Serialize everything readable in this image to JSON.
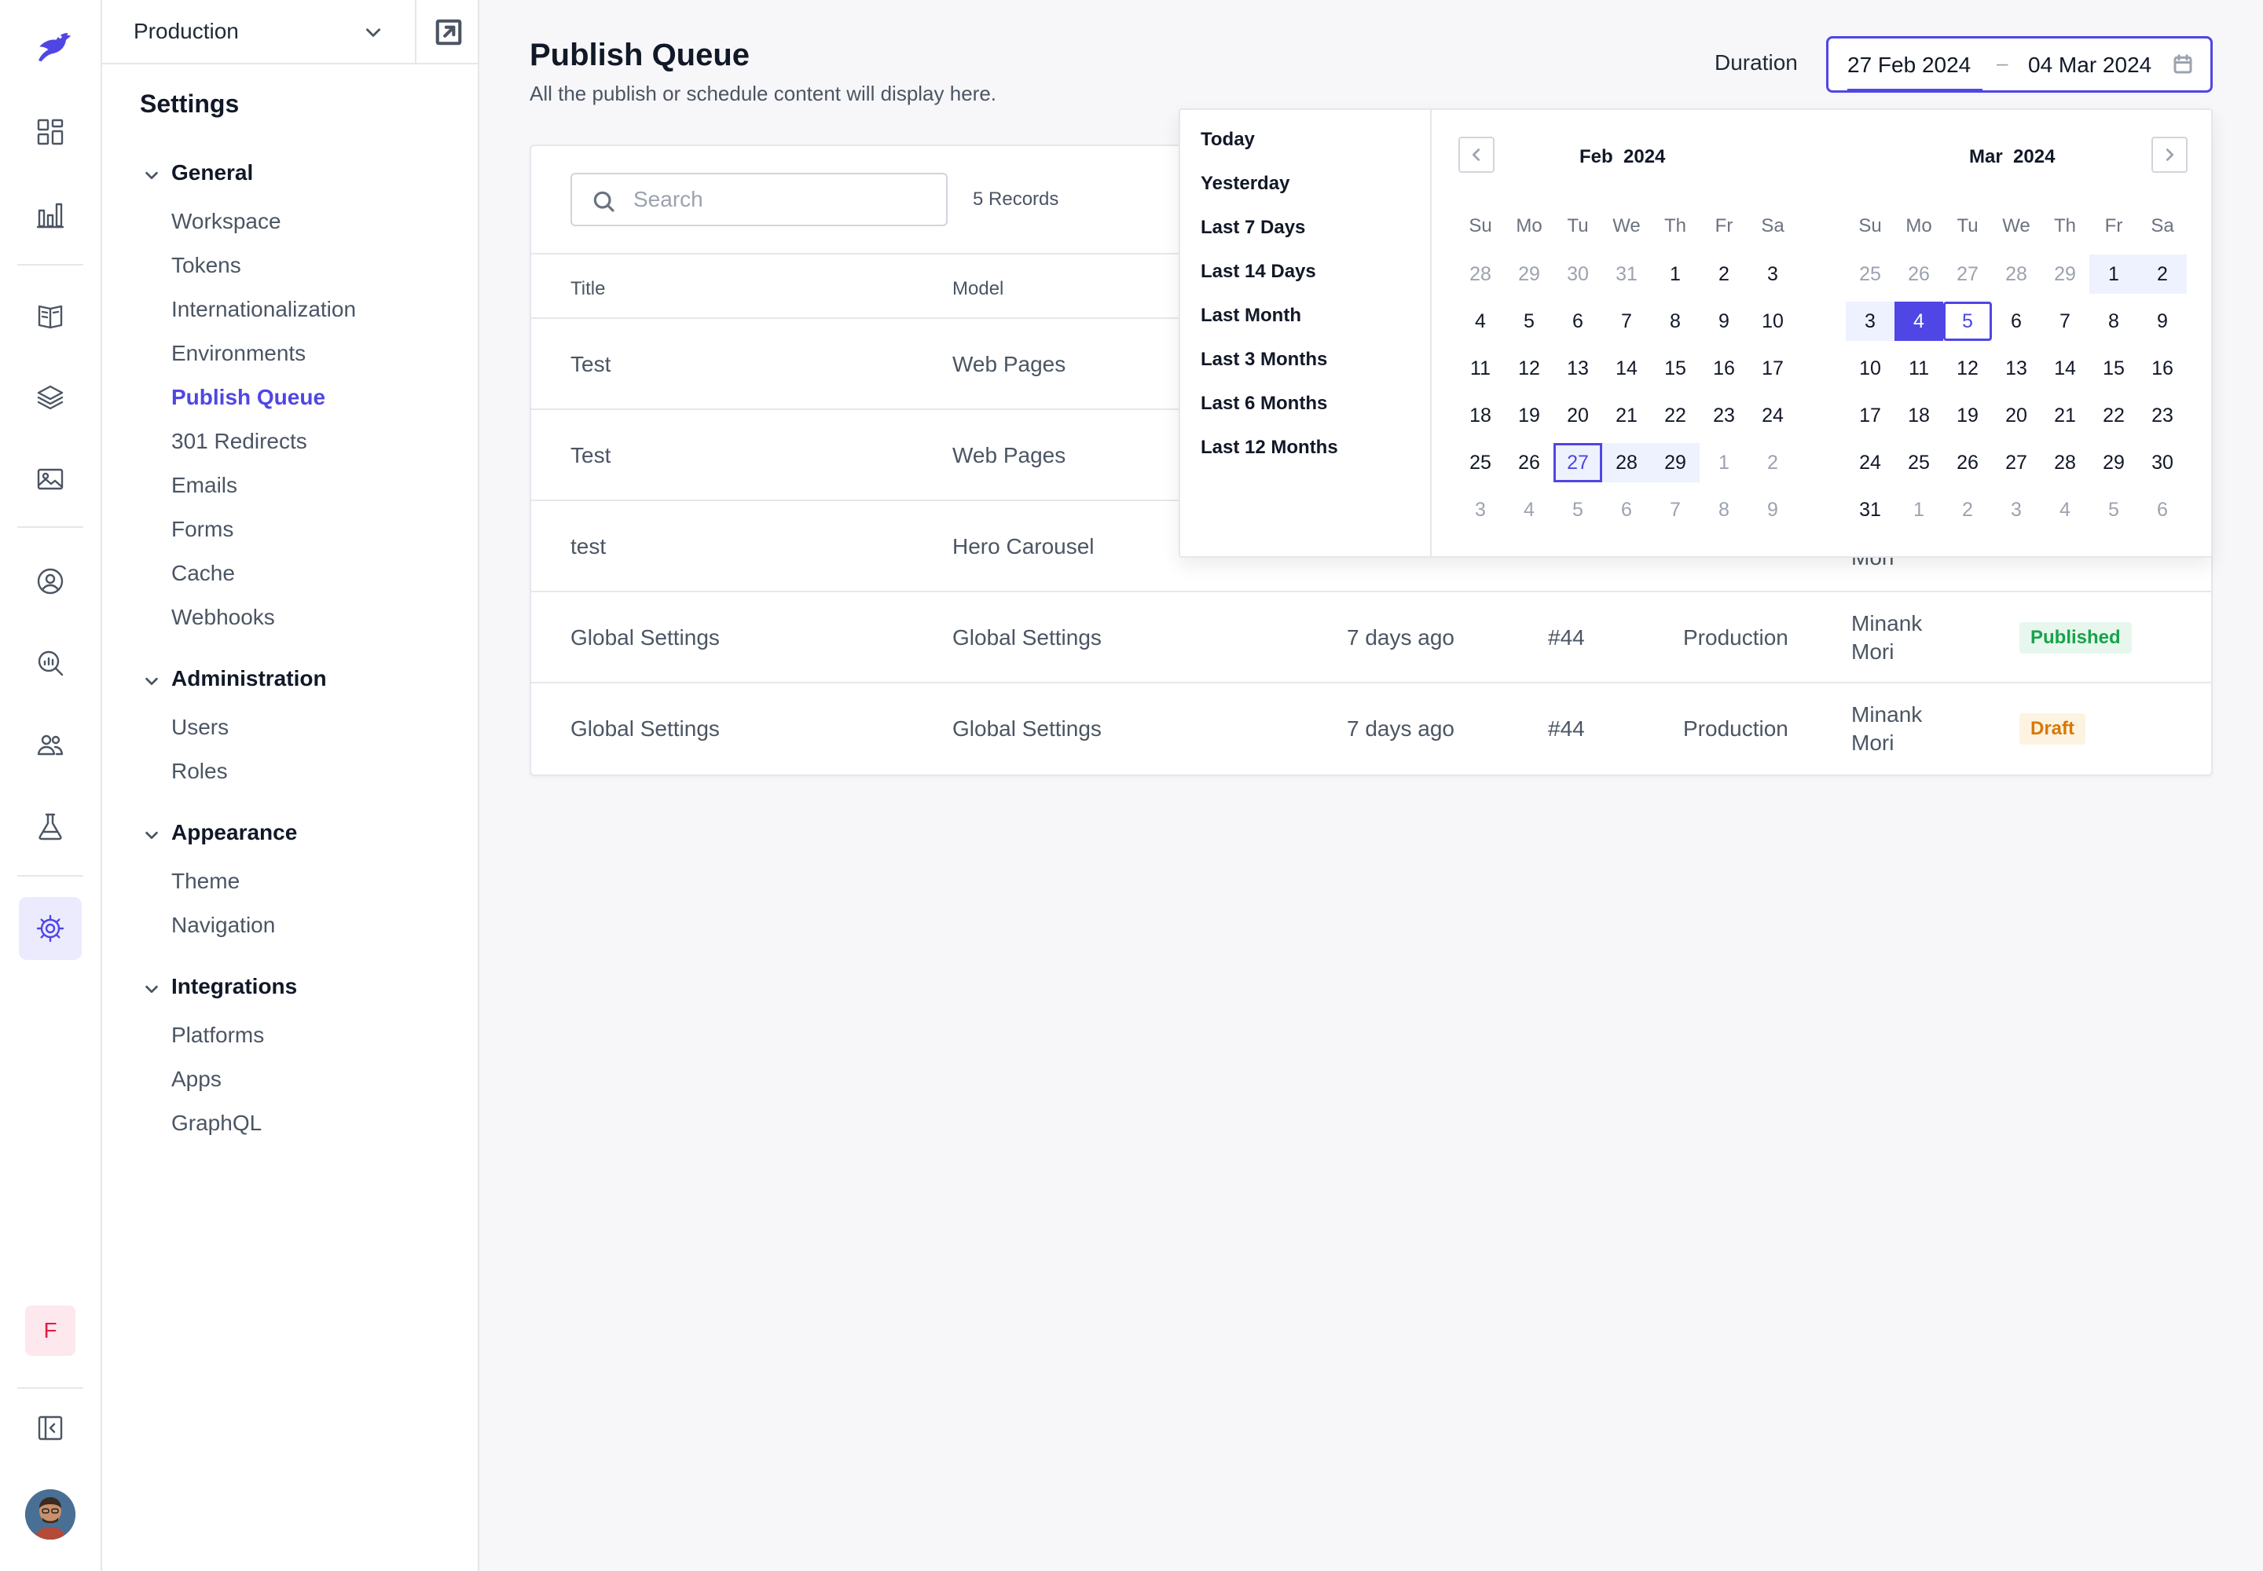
{
  "sidebar": {
    "environment": "Production",
    "heading": "Settings",
    "groups": [
      {
        "label": "General",
        "items": [
          "Workspace",
          "Tokens",
          "Internationalization",
          "Environments",
          "Publish Queue",
          "301 Redirects",
          "Emails",
          "Forms",
          "Cache",
          "Webhooks"
        ]
      },
      {
        "label": "Administration",
        "items": [
          "Users",
          "Roles"
        ]
      },
      {
        "label": "Appearance",
        "items": [
          "Theme",
          "Navigation"
        ]
      },
      {
        "label": "Integrations",
        "items": [
          "Platforms",
          "Apps",
          "GraphQL"
        ]
      }
    ],
    "active_item": "Publish Queue",
    "user_initial": "F"
  },
  "header": {
    "title": "Publish Queue",
    "subtitle": "All the publish or schedule content will display here.",
    "duration_label": "Duration",
    "date_from": "27 Feb 2024",
    "date_separator": "–",
    "date_to": "04 Mar 2024"
  },
  "table": {
    "search_placeholder": "Search",
    "records": "5 Records",
    "columns": [
      "Title",
      "Model"
    ],
    "rows": [
      {
        "title": "Test",
        "model": "Web Pages",
        "time": "",
        "id": "",
        "env": "",
        "user": "",
        "status": ""
      },
      {
        "title": "Test",
        "model": "Web Pages",
        "time": "",
        "id": "",
        "env": "",
        "user": "",
        "status": ""
      },
      {
        "title": "test",
        "model": "Hero Carousel",
        "time": "",
        "id": "",
        "env": "",
        "user": "Mori",
        "status": ""
      },
      {
        "title": "Global Settings",
        "model": "Global Settings",
        "time": "7 days ago",
        "id": "#44",
        "env": "Production",
        "user_first": "Minank",
        "user": "Mori",
        "status": "Published"
      },
      {
        "title": "Global Settings",
        "model": "Global Settings",
        "time": "7 days ago",
        "id": "#44",
        "env": "Production",
        "user_first": "Minank",
        "user": "Mori",
        "status": "Draft"
      }
    ]
  },
  "datepicker": {
    "presets": [
      "Today",
      "Yesterday",
      "Last 7 Days",
      "Last 14 Days",
      "Last Month",
      "Last 3 Months",
      "Last 6 Months",
      "Last 12 Months"
    ],
    "weekdays": [
      "Su",
      "Mo",
      "Tu",
      "We",
      "Th",
      "Fr",
      "Sa"
    ],
    "months": [
      {
        "month": "Feb",
        "year": "2024",
        "weeks": [
          [
            "28",
            "29",
            "30",
            "31",
            "1",
            "2",
            "3"
          ],
          [
            "4",
            "5",
            "6",
            "7",
            "8",
            "9",
            "10"
          ],
          [
            "11",
            "12",
            "13",
            "14",
            "15",
            "16",
            "17"
          ],
          [
            "18",
            "19",
            "20",
            "21",
            "22",
            "23",
            "24"
          ],
          [
            "25",
            "26",
            "27",
            "28",
            "29",
            "1",
            "2"
          ],
          [
            "3",
            "4",
            "5",
            "6",
            "7",
            "8",
            "9"
          ]
        ],
        "current_month_first_index": 4,
        "current_month_last_index": 32,
        "range_cells": [
          30,
          31,
          32
        ],
        "outlined_cells": [
          30
        ],
        "selected_cells": []
      },
      {
        "month": "Mar",
        "year": "2024",
        "weeks": [
          [
            "25",
            "26",
            "27",
            "28",
            "29",
            "1",
            "2"
          ],
          [
            "3",
            "4",
            "5",
            "6",
            "7",
            "8",
            "9"
          ],
          [
            "10",
            "11",
            "12",
            "13",
            "14",
            "15",
            "16"
          ],
          [
            "17",
            "18",
            "19",
            "20",
            "21",
            "22",
            "23"
          ],
          [
            "24",
            "25",
            "26",
            "27",
            "28",
            "29",
            "30"
          ],
          [
            "31",
            "1",
            "2",
            "3",
            "4",
            "5",
            "6"
          ]
        ],
        "current_month_first_index": 5,
        "current_month_last_index": 35,
        "range_cells": [
          5,
          6,
          7,
          8
        ],
        "outlined_cells": [
          9
        ],
        "selected_cells": [
          8
        ]
      }
    ]
  },
  "colors": {
    "accent": "#4f46e5",
    "published": "#16a34a",
    "draft": "#d97706"
  }
}
